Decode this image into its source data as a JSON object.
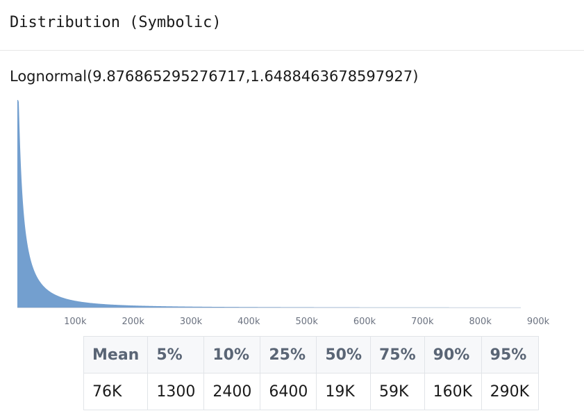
{
  "header": {
    "title": "Distribution (Symbolic)"
  },
  "expression": "Lognormal(9.876865295276717,1.6488463678597927)",
  "chart_data": {
    "type": "area",
    "distribution": {
      "family": "lognormal",
      "mu": 9.876865295276717,
      "sigma": 1.6488463678597927
    },
    "x_tick_labels": [
      "100k",
      "200k",
      "300k",
      "400k",
      "500k",
      "600k",
      "700k",
      "800k",
      "900k"
    ],
    "x_tick_values": [
      100000,
      200000,
      300000,
      400000,
      500000,
      600000,
      700000,
      800000,
      900000
    ],
    "xlim": [
      0,
      870000
    ],
    "grid": false,
    "fill_color": "#739fcf",
    "axis_color": "#d9dde3",
    "tick_label_color": "#6b7280"
  },
  "stats": {
    "headers": [
      "Mean",
      "5%",
      "10%",
      "25%",
      "50%",
      "75%",
      "90%",
      "95%"
    ],
    "values": [
      "76K",
      "1300",
      "2400",
      "6400",
      "19K",
      "59K",
      "160K",
      "290K"
    ]
  }
}
